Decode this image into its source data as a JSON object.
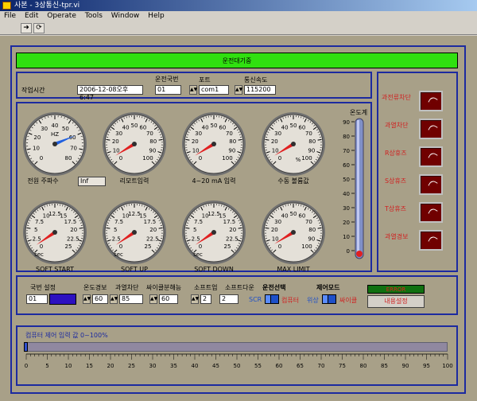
{
  "window": {
    "title": "사본 - 3상통신-tpr.vi"
  },
  "menu": [
    "File",
    "Edit",
    "Operate",
    "Tools",
    "Window",
    "Help"
  ],
  "toolbar": {
    "run_icon": "arrow-right-icon",
    "run_continuous_icon": "refresh-icon"
  },
  "status_banner": "운전대기중",
  "info": {
    "time_label": "작업시간",
    "time_value": "2006-12-08오후 6:47",
    "unit_label": "운전국번",
    "unit_value": "01",
    "port_label": "포트",
    "port_value": "com1",
    "baud_label": "통신속도",
    "baud_value": "115200"
  },
  "gauges": [
    {
      "label": "전원 주파수",
      "unit": "HZ",
      "ticks": [
        "0",
        "10",
        "20",
        "30",
        "40",
        "50",
        "60",
        "70",
        "80"
      ],
      "value": 60,
      "min": 0,
      "max": 80,
      "needle_color": "#2060e0",
      "readout": "Inf"
    },
    {
      "label": "리모트입력",
      "unit": "",
      "ticks": [
        "0",
        "10",
        "20",
        "30",
        "40",
        "50",
        "60",
        "70",
        "80",
        "90",
        "100"
      ],
      "value": 5,
      "min": 0,
      "max": 100,
      "needle_color": "#e02020"
    },
    {
      "label": "4~20 mA 입력",
      "unit": "",
      "ticks": [
        "0",
        "10",
        "20",
        "30",
        "40",
        "50",
        "60",
        "70",
        "80",
        "90",
        "100"
      ],
      "value": 5,
      "min": 0,
      "max": 100,
      "needle_color": "#e02020"
    },
    {
      "label": "수동 볼륨값",
      "unit": "%",
      "ticks": [
        "0",
        "10",
        "20",
        "30",
        "40",
        "50",
        "60",
        "70",
        "80",
        "90",
        "100"
      ],
      "value": 5,
      "min": 0,
      "max": 100,
      "needle_color": "#e02020"
    },
    {
      "label": "SOFT START",
      "unit": "sec",
      "ticks": [
        "0",
        "2.5",
        "5",
        "7.5",
        "10",
        "12.5",
        "15",
        "17.5",
        "20",
        "22.5",
        "25"
      ],
      "value": 1,
      "min": 0,
      "max": 25,
      "needle_color": "#e02020"
    },
    {
      "label": "SOFT UP",
      "unit": "sec",
      "ticks": [
        "0",
        "2.5",
        "5",
        "7.5",
        "10",
        "12.5",
        "15",
        "17.5",
        "20",
        "22.5",
        "25"
      ],
      "value": 1,
      "min": 0,
      "max": 25,
      "needle_color": "#e02020"
    },
    {
      "label": "SOFT DOWN",
      "unit": "sec",
      "ticks": [
        "0",
        "2.5",
        "5",
        "7.5",
        "10",
        "12.5",
        "15",
        "17.5",
        "20",
        "22.5",
        "25"
      ],
      "value": 1,
      "min": 0,
      "max": 25,
      "needle_color": "#e02020"
    },
    {
      "label": "MAX LIMIT",
      "unit": "",
      "ticks": [
        "0",
        "10",
        "20",
        "30",
        "40",
        "50",
        "60",
        "70",
        "80",
        "90",
        "100"
      ],
      "value": 5,
      "min": 0,
      "max": 100,
      "needle_color": "#e02020"
    }
  ],
  "thermometer": {
    "label": "온도계",
    "ticks": [
      "0",
      "10",
      "20",
      "30",
      "40",
      "50",
      "60",
      "70",
      "80",
      "90"
    ],
    "value": 0,
    "max": 90
  },
  "alarms": [
    {
      "label": "과전류차단"
    },
    {
      "label": "과열차단"
    },
    {
      "label": "R상휴즈"
    },
    {
      "label": "S상휴즈"
    },
    {
      "label": "T상휴즈"
    },
    {
      "label": "과열경보"
    }
  ],
  "settings": {
    "unit_label": "국번 설정",
    "unit_value": "01",
    "temp_warn_label": "온도경보",
    "temp_warn_value": "60",
    "over_heat_label": "과열차단",
    "over_heat_value": "85",
    "cycle_label": "싸이클분해능",
    "cycle_value": "60",
    "softup_label": "소프트업",
    "softup_value": "2",
    "softdown_label": "소프트다운",
    "softdown_value": "2",
    "run_sel_label": "운전선택",
    "run_left": "SCR",
    "run_right": "컴퓨터",
    "ctrl_label": "제어모드",
    "ctrl_left": "위상",
    "ctrl_right": "싸이클",
    "error_label": "ERROR",
    "content_btn": "내용설정"
  },
  "slider": {
    "label": "컴퓨터 제어 입력 값  0~100%",
    "ticks": [
      "0",
      "5",
      "10",
      "15",
      "20",
      "25",
      "30",
      "35",
      "40",
      "45",
      "50",
      "55",
      "60",
      "65",
      "70",
      "75",
      "80",
      "85",
      "90",
      "95",
      "100"
    ],
    "value": 0
  },
  "colors": {
    "panel": "#a8a088",
    "frame": "#1c2aa0",
    "banner": "#30e010",
    "alarm_text": "#d02020"
  }
}
